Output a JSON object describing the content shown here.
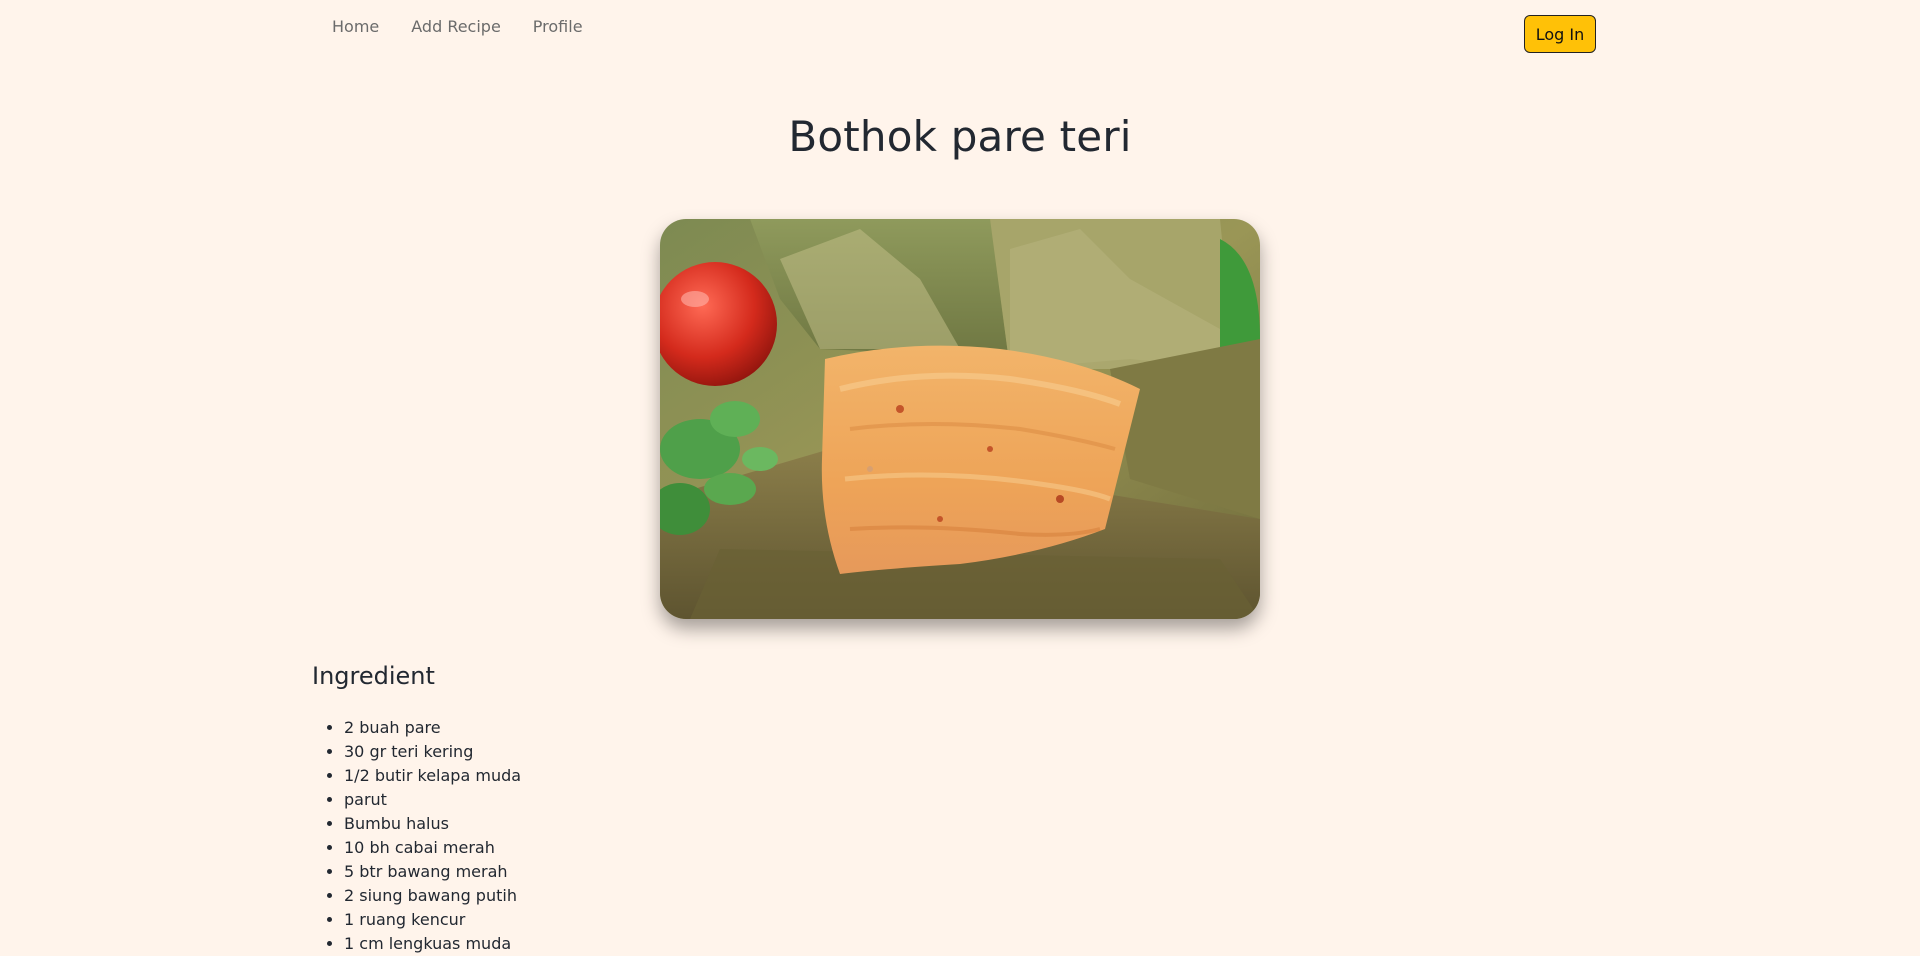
{
  "nav": {
    "links": [
      {
        "label": "Home"
      },
      {
        "label": "Add Recipe"
      },
      {
        "label": "Profile"
      }
    ],
    "login_label": "Log In"
  },
  "recipe": {
    "title": "Bothok pare teri",
    "image_icon": "food-photo-bothok-in-banana-leaf",
    "ingredients_heading": "Ingredient",
    "ingredients": [
      "2 buah pare",
      "30 gr teri kering",
      "1/2 butir kelapa muda",
      "parut",
      "Bumbu halus",
      "10 bh cabai merah",
      "5 btr bawang merah",
      "2 siung bawang putih",
      "1 ruang kencur",
      "1 cm lengkuas muda"
    ]
  },
  "colors": {
    "background": "#fff4eb",
    "accent": "#ffc107",
    "text": "#222831",
    "nav_text": "#6b6b6b"
  }
}
